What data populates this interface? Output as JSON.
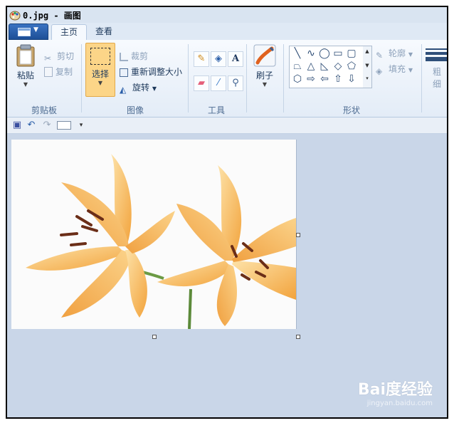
{
  "window": {
    "title": "0.jpg - 画图"
  },
  "tabs": [
    {
      "label": "主页"
    },
    {
      "label": "查看"
    }
  ],
  "clipboard": {
    "paste": "粘贴",
    "cut": "剪切",
    "copy": "复制",
    "group": "剪贴板"
  },
  "image_group": {
    "select": "选择",
    "crop": "裁剪",
    "resize": "重新调整大小",
    "rotate": "旋转",
    "group": "图像"
  },
  "tools_group": {
    "group": "工具"
  },
  "brushes": {
    "label": "刷子"
  },
  "shapes_group": {
    "outline": "轮廓",
    "fill": "填充",
    "group": "形状"
  },
  "size": {
    "label_1": "粗",
    "label_2": "细"
  },
  "watermark": {
    "main": "Bai度经验",
    "sub": "jingyan.baidu.com"
  },
  "colors": {
    "accent": "#2a5ea8",
    "ribbon": "#e3ecf7",
    "canvas_bg": "#c9d6e8"
  }
}
